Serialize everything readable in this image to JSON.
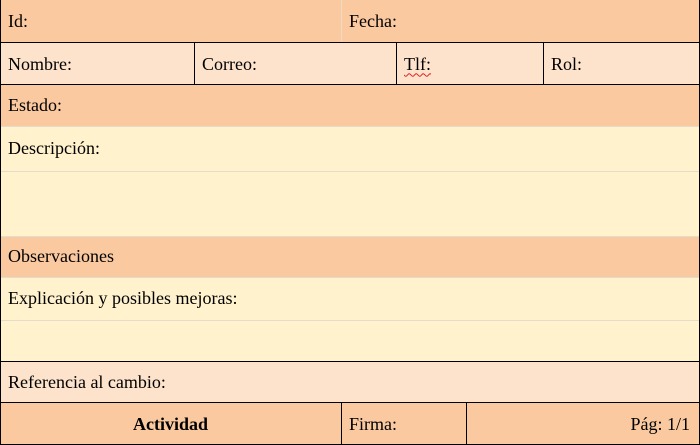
{
  "row1": {
    "id_label": "Id:",
    "fecha_label": "Fecha:"
  },
  "row2": {
    "nombre_label": "Nombre:",
    "correo_label": "Correo:",
    "tlf_label": "Tlf:",
    "rol_label": "Rol:"
  },
  "row3": {
    "estado_label": "Estado:"
  },
  "row4": {
    "descripcion_label": "Descripción:"
  },
  "row6": {
    "observaciones_label": "Observaciones"
  },
  "row7": {
    "explicacion_label": "Explicación y posibles mejoras:"
  },
  "row9": {
    "referencia_label": "Referencia al cambio:"
  },
  "footer": {
    "actividad_label": "Actividad",
    "firma_label": "Firma:",
    "pagina_label": "Pág: 1/1"
  },
  "colors": {
    "orange": "#fbc9a0",
    "peach": "#fde3cc",
    "cream": "#fff2cd"
  }
}
